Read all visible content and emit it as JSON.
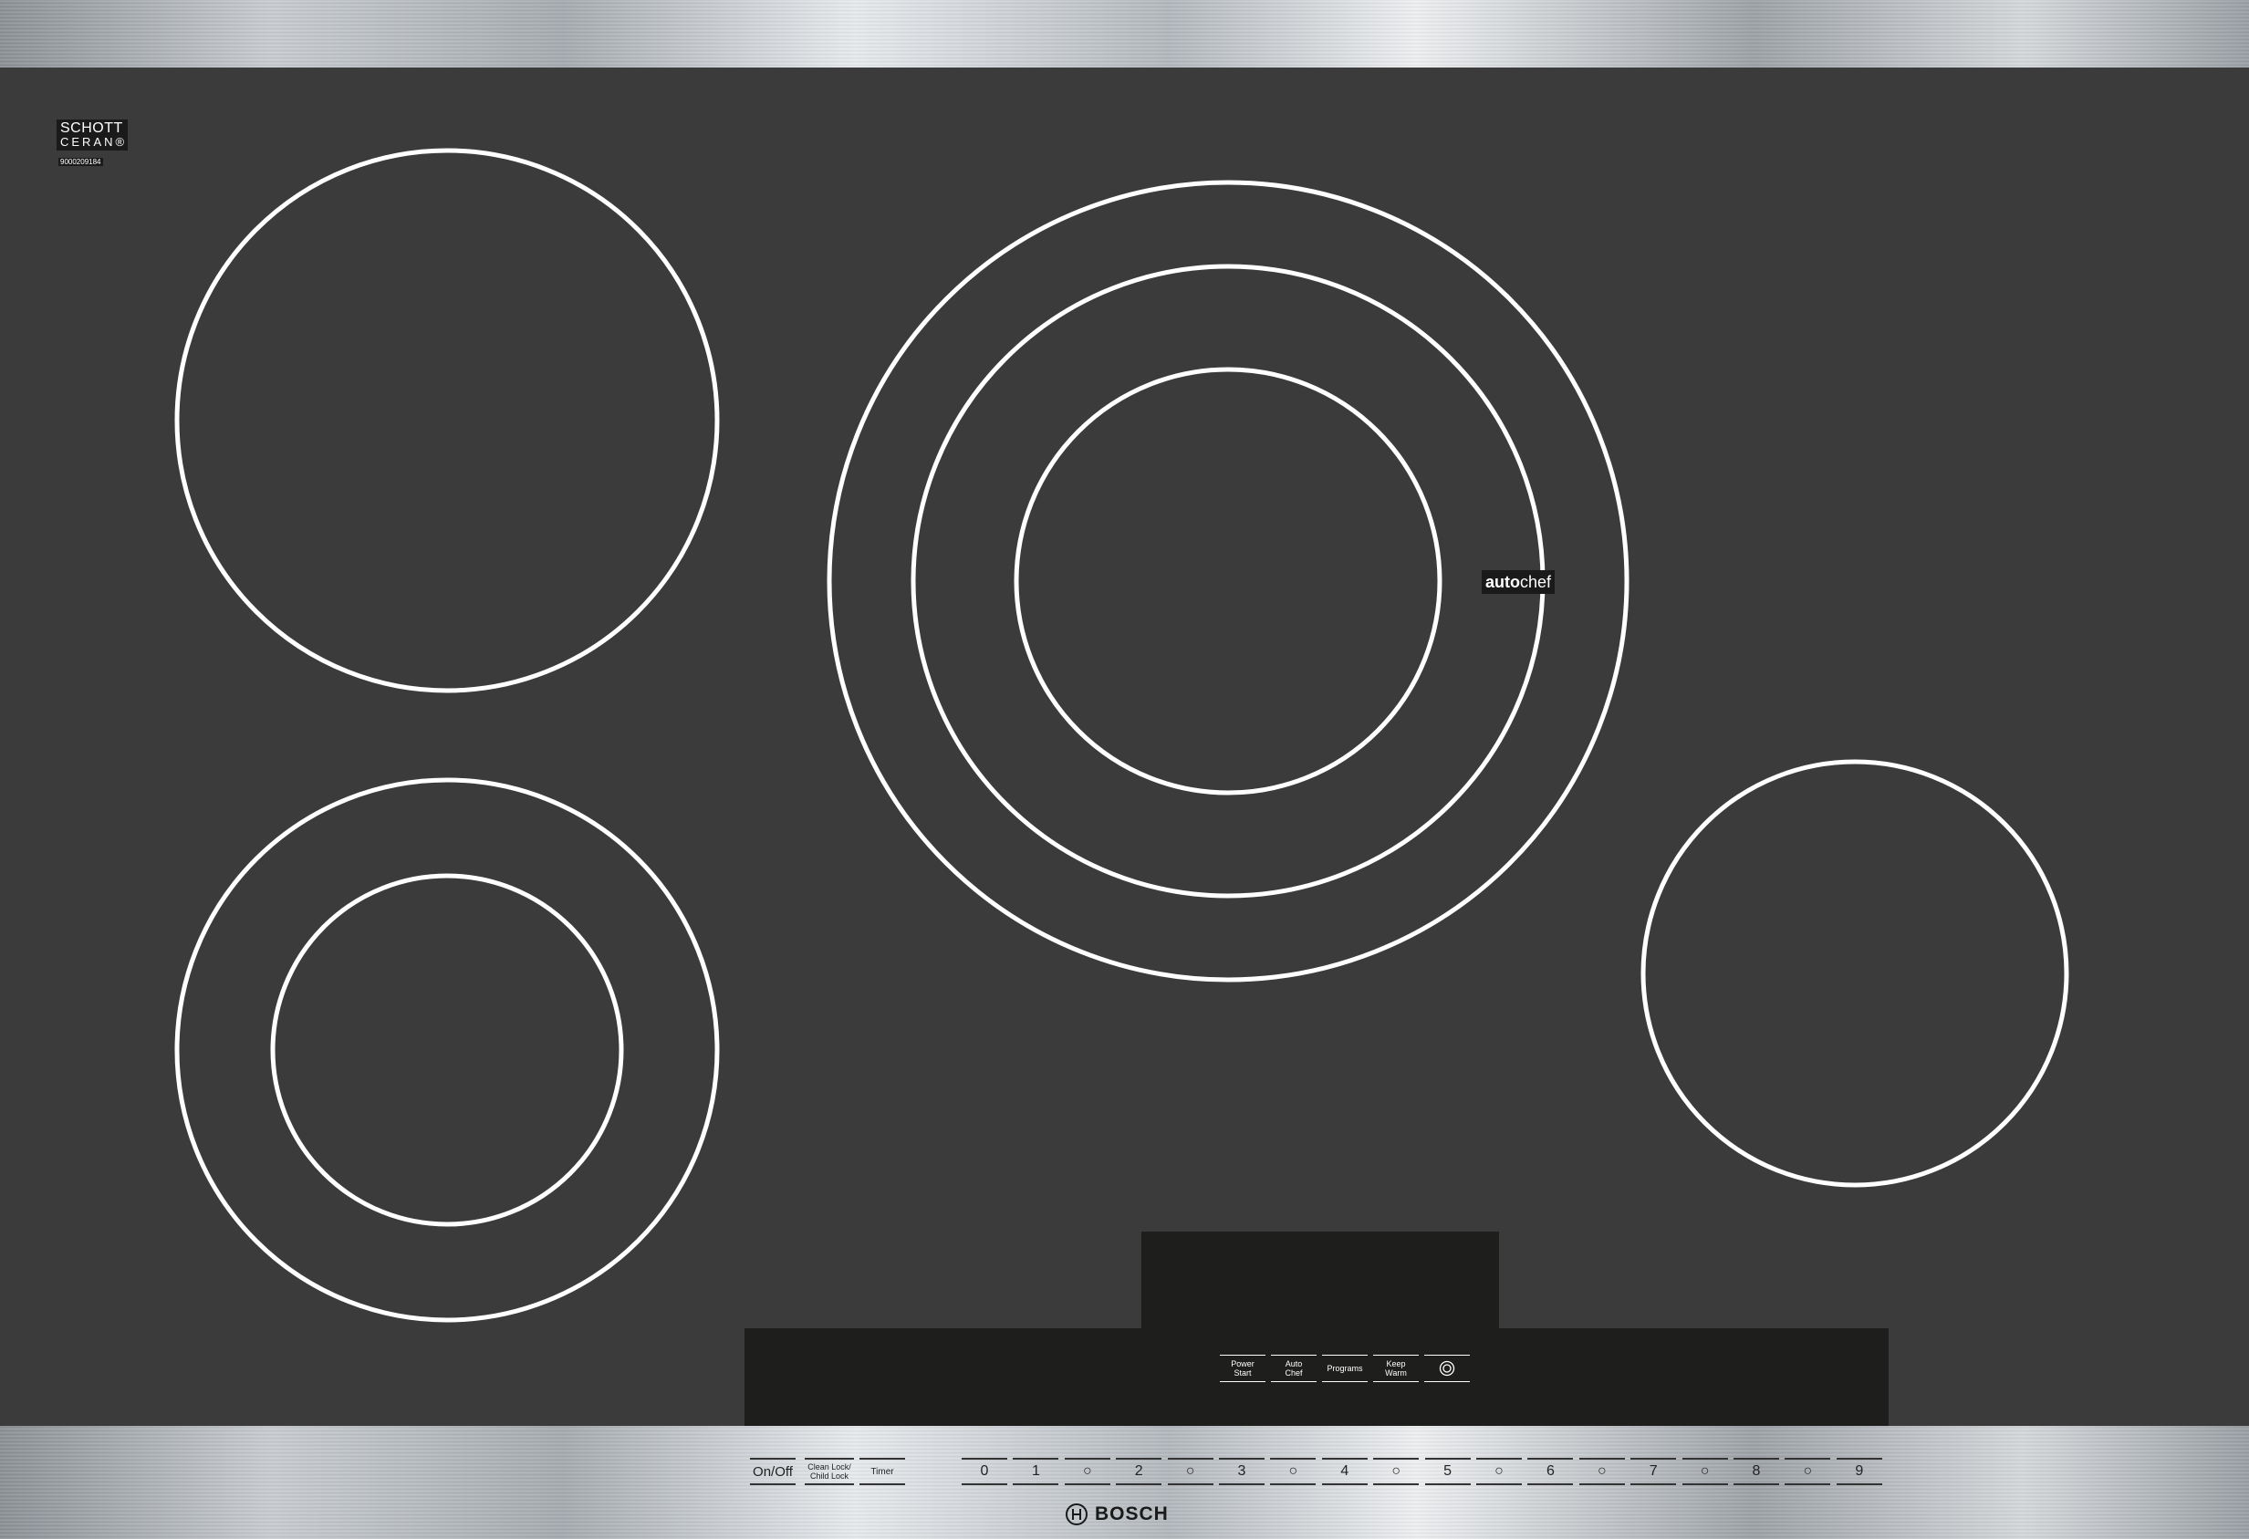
{
  "brand": {
    "name": "BOSCH",
    "icon": "bosch-logo-icon"
  },
  "glass": {
    "manufacturer_line1": "SCHOTT",
    "manufacturer_line2": "CERAN",
    "manufacturer_mark": "®",
    "code": "9000209184",
    "autochef_bold": "auto",
    "autochef_light": "chef"
  },
  "colors": {
    "glass": "#3b3b3b",
    "panel": "#1e1e1c",
    "ring": "#ffffff",
    "steel": "#c9cdd1"
  },
  "panel_buttons": [
    {
      "name": "power-start-button",
      "label": "Power\nStart"
    },
    {
      "name": "auto-chef-button",
      "label": "Auto\nChef"
    },
    {
      "name": "programs-button",
      "label": "Programs"
    },
    {
      "name": "keep-warm-button",
      "label": "Keep\nWarm"
    },
    {
      "name": "dual-ring-button",
      "icon": "double-circle-icon"
    }
  ],
  "controls": {
    "on_off": "On/Off",
    "clean_lock": "Clean Lock/\nChild Lock",
    "timer": "Timer"
  },
  "levels": [
    "0",
    "1",
    "○",
    "2",
    "○",
    "3",
    "○",
    "4",
    "○",
    "5",
    "○",
    "6",
    "○",
    "7",
    "○",
    "8",
    "○",
    "9"
  ]
}
